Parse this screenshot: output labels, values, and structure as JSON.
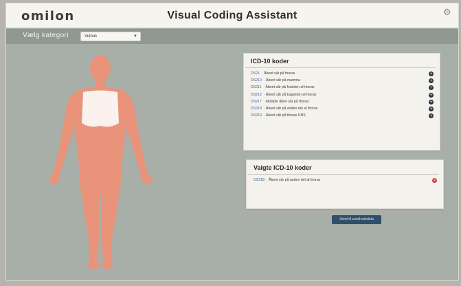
{
  "header": {
    "logo": "omilon",
    "title": "Visual Coding Assistant",
    "settings_icon": "gear-icon"
  },
  "category": {
    "label": "Vælg kategori",
    "selected": "Vulnus"
  },
  "icd_panel": {
    "title": "ICD-10 koder",
    "items": [
      {
        "code": "DS21",
        "text": "Åbent sår på thorax"
      },
      {
        "code": "DS210",
        "text": "Åbent sår på mamma"
      },
      {
        "code": "DS211",
        "text": "Åbent sår på forsiden af thorax"
      },
      {
        "code": "DS212",
        "text": "Åbent sår på bagsiden af thorax"
      },
      {
        "code": "DS217",
        "text": "Multiple åbne sår på thorax"
      },
      {
        "code": "DS218",
        "text": "Åbent sår på anden del af thorax"
      },
      {
        "code": "DS219",
        "text": "Åbent sår på thorax UNS"
      }
    ]
  },
  "selected_panel": {
    "title": "Valgte ICD-10 koder",
    "items": [
      {
        "code": "DS218",
        "text": "Åbent sår på anden del af thorax"
      }
    ]
  },
  "send_button": "Send til sundhedsdata",
  "colors": {
    "body": "#e8937a",
    "highlight": "#fbf2ee",
    "accent_button": "#2f4f6b",
    "remove": "#c93a3a"
  }
}
